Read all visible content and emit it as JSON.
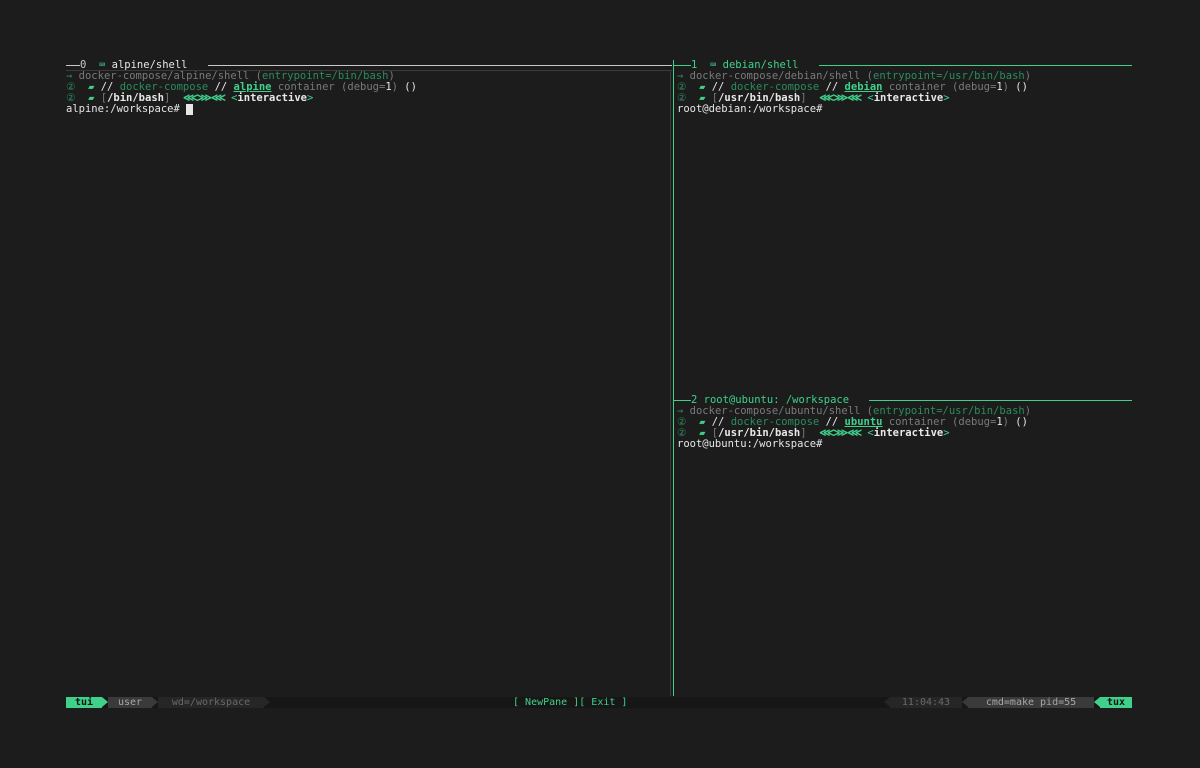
{
  "panes": [
    {
      "index": "0",
      "title": "alpine/shell",
      "info_path": "docker-compose/alpine/shell",
      "info_entry": "entrypoint=/bin/bash",
      "tool": "docker-compose",
      "image": "alpine",
      "cmd": "/bin/bash",
      "mode": "interactive",
      "prompt": "alpine:/workspace#",
      "active": true
    },
    {
      "index": "1",
      "title": "debian/shell",
      "info_path": "docker-compose/debian/shell",
      "info_entry": "entrypoint=/usr/bin/bash",
      "tool": "docker-compose",
      "image": "debian",
      "cmd": "/usr/bin/bash",
      "mode": "interactive",
      "prompt": "root@debian:/workspace#",
      "active": false
    },
    {
      "index": "2",
      "title": "root@ubuntu: /workspace",
      "info_path": "docker-compose/ubuntu/shell",
      "info_entry": "entrypoint=/usr/bin/bash",
      "tool": "docker-compose",
      "image": "ubuntu",
      "cmd": "/usr/bin/bash",
      "mode": "interactive",
      "prompt": "root@ubuntu:/workspace#",
      "active": false
    }
  ],
  "common": {
    "container_word": "container",
    "debug_label": "debug=",
    "debug_value": "1",
    "parens": "()",
    "slashes": "//"
  },
  "statusbar": {
    "session": "tui",
    "user": "user",
    "wd": "wd=/workspace",
    "new_pane": "NewPane",
    "exit": "Exit",
    "time": "11:04:43",
    "cmd": "cmd=make pid=55",
    "host": "tux"
  },
  "colors": {
    "background": "#1c1c1c",
    "accent": "#3fd18a",
    "accent_dark": "#2a8c5e",
    "status_bg": "#161616"
  }
}
